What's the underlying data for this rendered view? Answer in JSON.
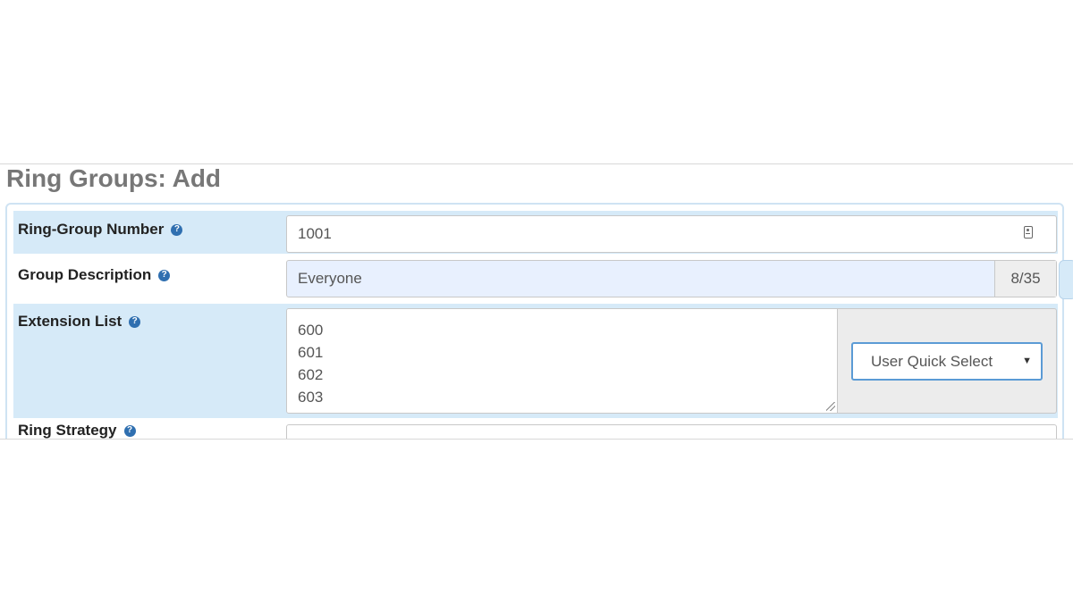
{
  "page": {
    "title": "Ring Groups: Add"
  },
  "form": {
    "ring_group_number": {
      "label": "Ring-Group Number",
      "value": "1001",
      "icon": "contact-card-icon"
    },
    "group_description": {
      "label": "Group Description",
      "value": "Everyone",
      "counter": "8/35"
    },
    "extension_list": {
      "label": "Extension List",
      "lines": [
        "600",
        "601",
        "602",
        "603"
      ],
      "quick_select_label": "User Quick Select"
    },
    "ring_strategy": {
      "label": "Ring Strategy"
    }
  },
  "icons": {
    "help": "?"
  },
  "colors": {
    "row_shade": "#d6eaf8",
    "help_icon": "#2f6fb0",
    "select_border": "#5b9bd5",
    "title": "#777777"
  }
}
